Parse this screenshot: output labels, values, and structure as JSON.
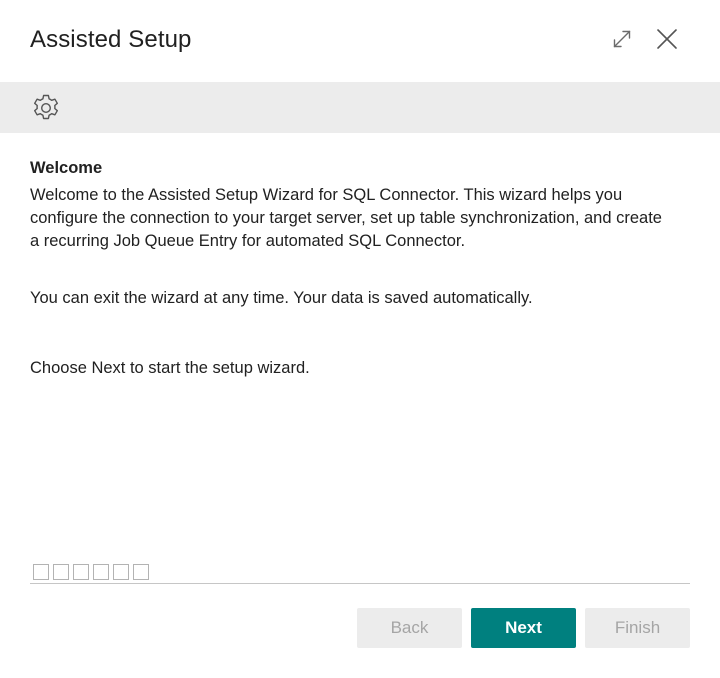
{
  "dialog": {
    "title": "Assisted Setup",
    "expand_icon": "expand-diagonal-icon",
    "close_icon": "close-icon"
  },
  "toolbar": {
    "settings_icon": "gear-icon"
  },
  "content": {
    "section_title": "Welcome",
    "paragraphs": [
      "Welcome to the Assisted Setup Wizard for SQL Connector. This wizard helps you configure the connection to your target server, set up table synchronization, and create a recurring Job Queue Entry for automated SQL Connector.",
      "You can exit the wizard at any time. Your data is saved automatically.",
      "Choose Next to start the setup wizard."
    ]
  },
  "progress": {
    "total_steps": 6,
    "current_step": 0
  },
  "footer": {
    "back_label": "Back",
    "next_label": "Next",
    "finish_label": "Finish",
    "back_enabled": false,
    "next_enabled": true,
    "finish_enabled": false
  },
  "colors": {
    "accent": "#00807f",
    "toolbar_bg": "#ececec",
    "disabled_text": "#a5a5a5"
  }
}
